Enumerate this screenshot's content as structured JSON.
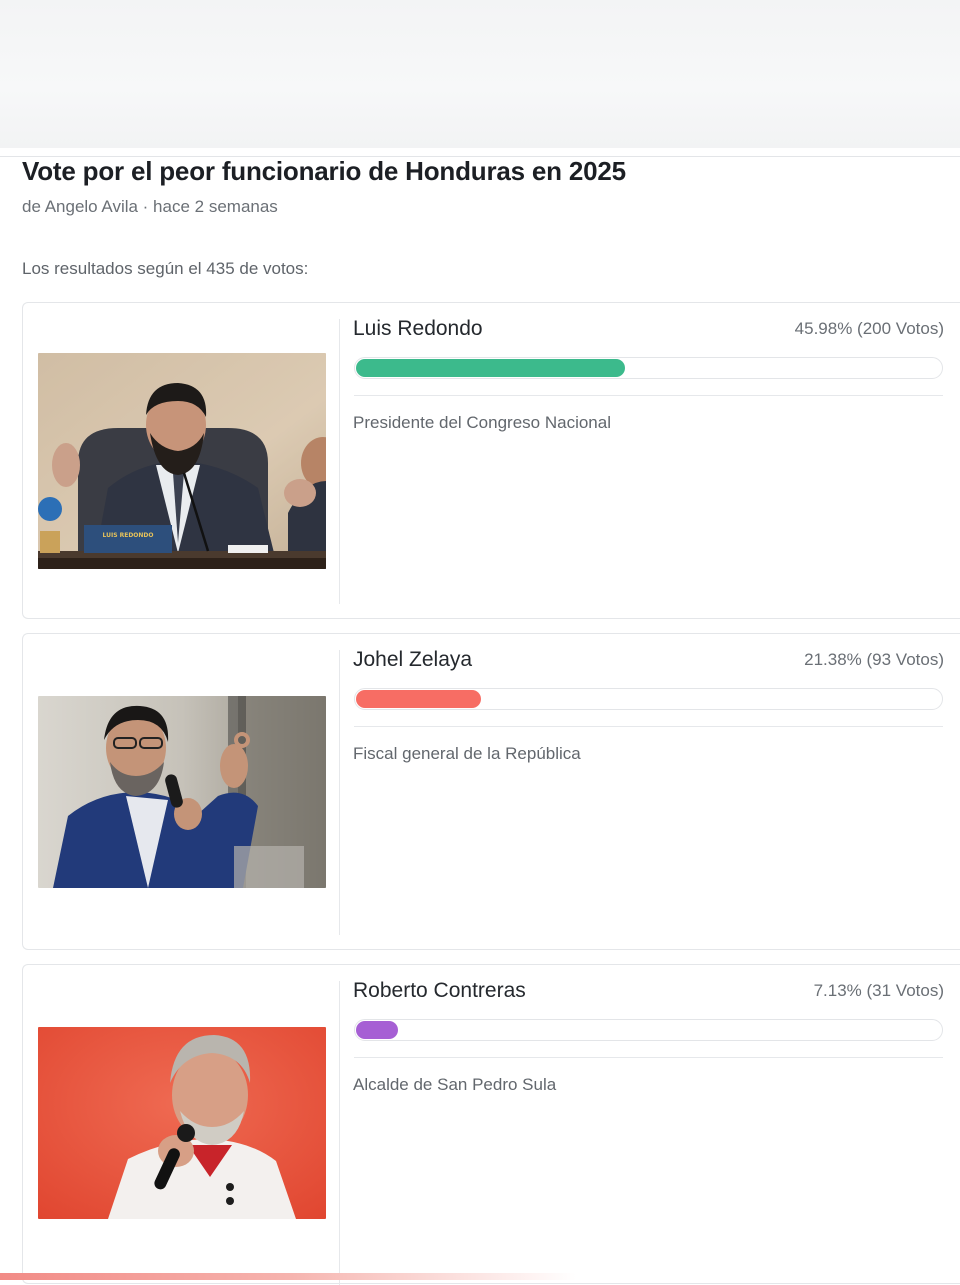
{
  "poll": {
    "title": "Vote por el peor funcionario de Honduras en 2025",
    "meta": "de Angelo Avila · hace 2 semanas",
    "results_summary": "Los resultados según el 435 de votos:"
  },
  "candidates": [
    {
      "name": "Luis Redondo",
      "stats": "45.98% (200 Votos)",
      "percent": 45.98,
      "role": "Presidente del Congreso Nacional",
      "bar_color": "#3cba8c",
      "photo_label": "LUIS REDONDO"
    },
    {
      "name": "Johel Zelaya",
      "stats": "21.38% (93 Votos)",
      "percent": 21.38,
      "role": "Fiscal general de la República",
      "bar_color": "#f76d64"
    },
    {
      "name": "Roberto Contreras",
      "stats": "7.13% (31 Votos)",
      "percent": 7.13,
      "role": "Alcalde de San Pedro Sula",
      "bar_color": "#a65fd4"
    }
  ]
}
